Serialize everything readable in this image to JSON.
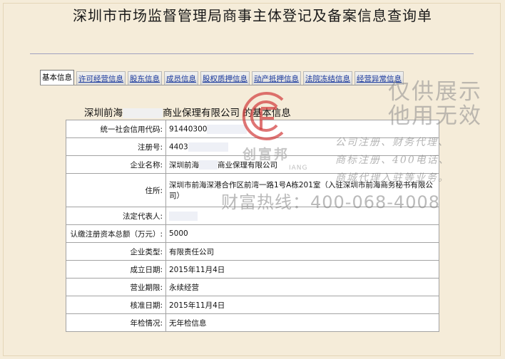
{
  "page": {
    "title": "深圳市市场监督管理局商事主体登记及备案信息查询单"
  },
  "tabs": [
    {
      "label": "基本信息",
      "active": true
    },
    {
      "label": "许可经营信息"
    },
    {
      "label": "股东信息"
    },
    {
      "label": "成员信息"
    },
    {
      "label": "股权质押信息"
    },
    {
      "label": "动产抵押信息"
    },
    {
      "label": "法院冻结信息"
    },
    {
      "label": "经营异常信息"
    }
  ],
  "company": {
    "heading_prefix": "深圳前海",
    "heading_name": "商业保理有限公司",
    "heading_suffix": "的基本信息"
  },
  "fields": [
    {
      "label": "统一社会信用代码:",
      "value": "91440300"
    },
    {
      "label": "注册号:",
      "value": "4403"
    },
    {
      "label": "企业名称:",
      "value": "深圳前海",
      "value2": "商业保理有限公司"
    },
    {
      "label": "住所:",
      "value": "深圳市前海深港合作区前湾一路1号A栋201室（入驻深圳市前海商务秘书有限公司）"
    },
    {
      "label": "法定代表人:",
      "value": ""
    },
    {
      "label": "认缴注册资本总额（万元）:",
      "value": "5000"
    },
    {
      "label": "企业类型:",
      "value": "有限责任公司"
    },
    {
      "label": "成立日期:",
      "value": "2015年11月4日"
    },
    {
      "label": "营业期限:",
      "value": "永续经营"
    },
    {
      "label": "核准日期:",
      "value": "2015年11月4日"
    },
    {
      "label": "年检情况:",
      "value": "无年检信息"
    }
  ],
  "watermark": {
    "line1": "仅供展示",
    "line2": "他用无效",
    "services1": "公司注册、财务代理、",
    "services2": "商标注册、400电话、",
    "services3": "商城代理入驻等业务。",
    "hotline": "财富热线：400-068-4008",
    "brand": "创富邦",
    "brand_sub": "IANG",
    "logo_color": "#d23a3a"
  }
}
